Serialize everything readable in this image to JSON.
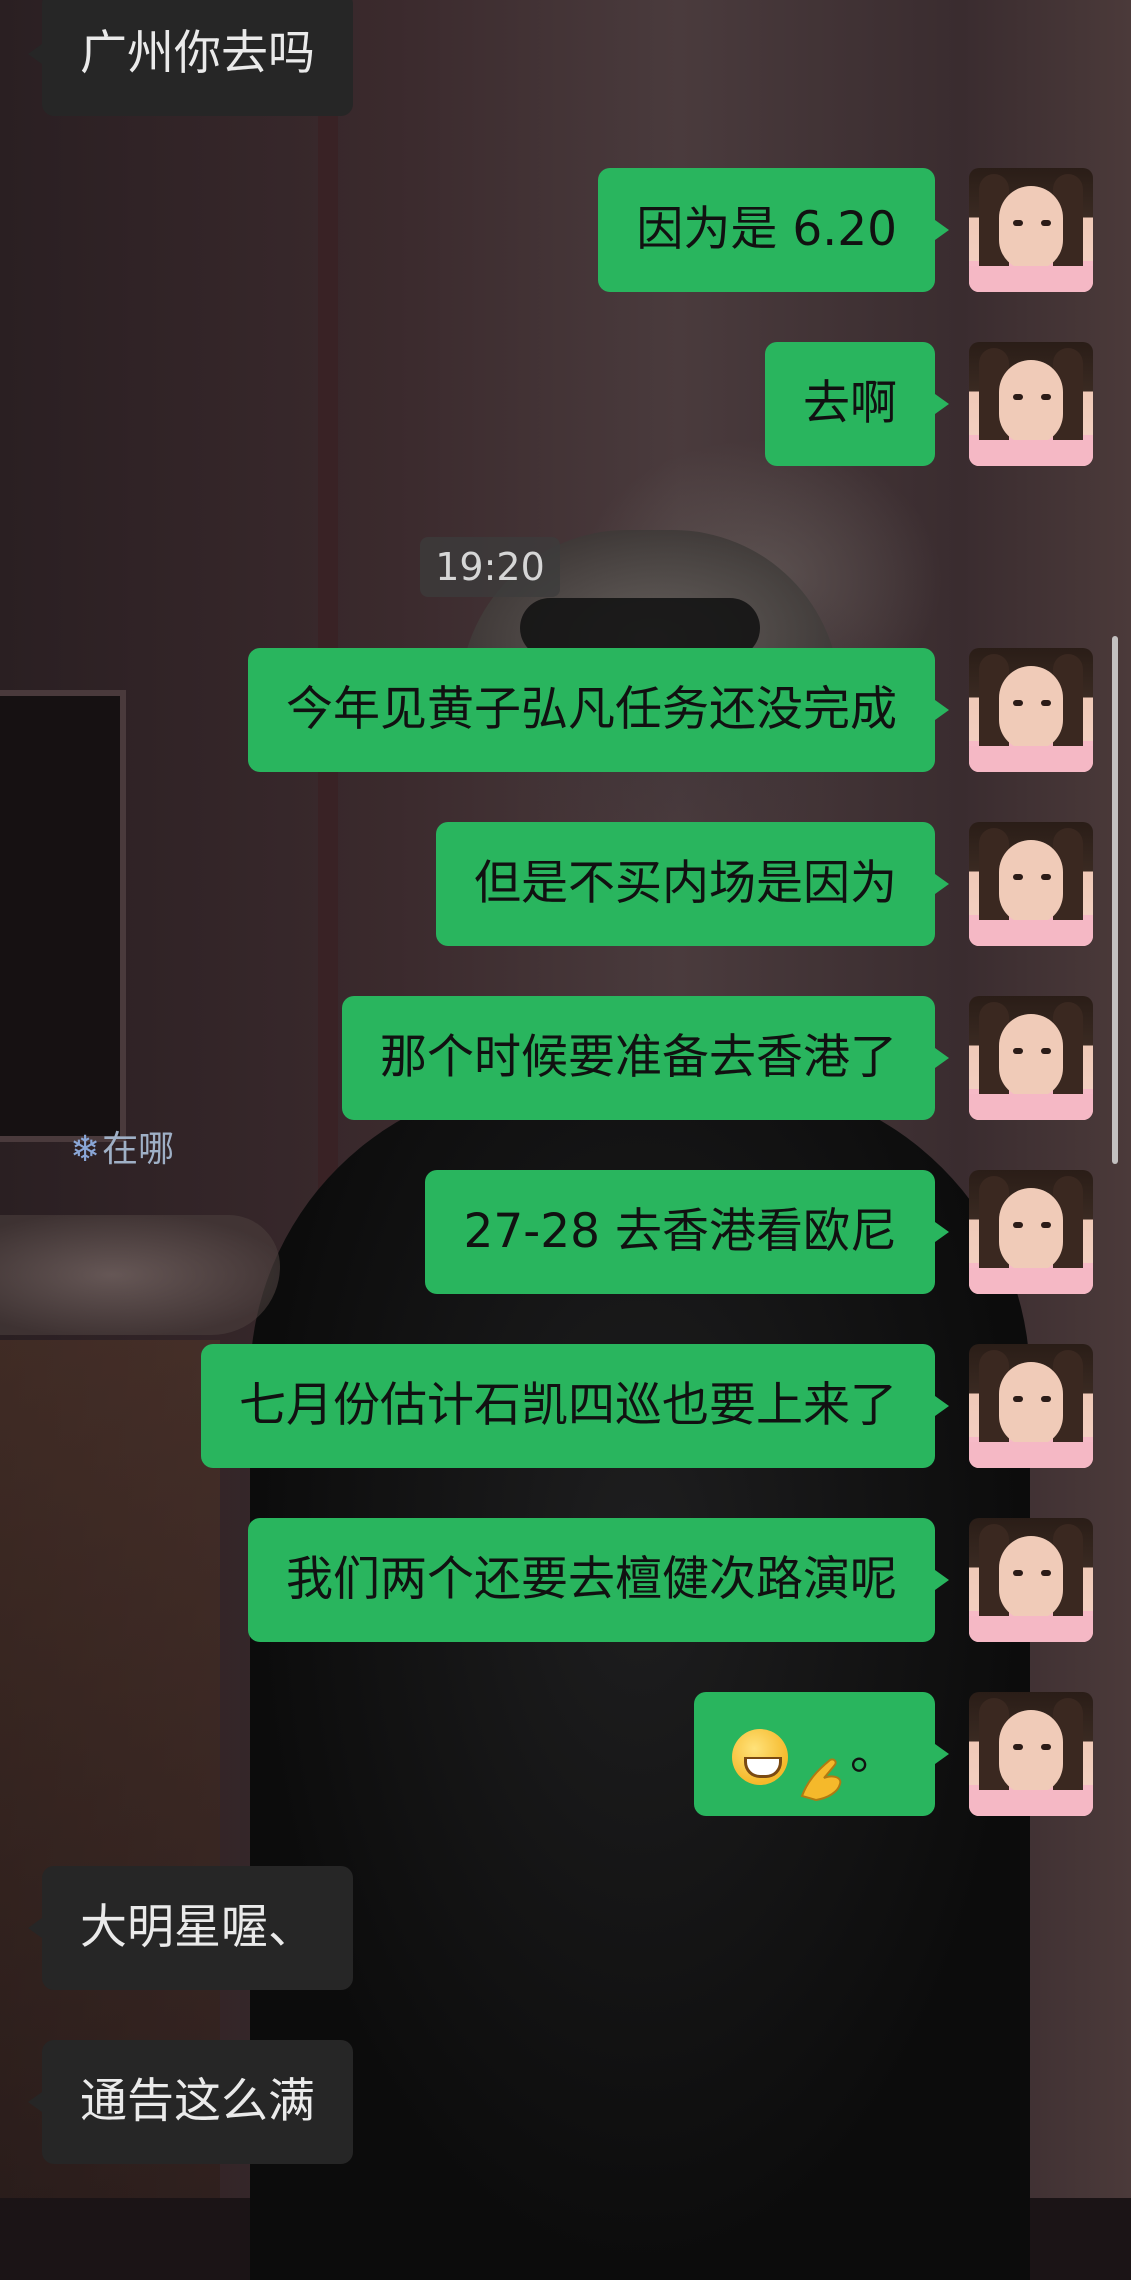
{
  "chat": {
    "timestamp": "19:20",
    "location_pin": "在哪",
    "messages": [
      {
        "side": "other",
        "text": "广州你去吗"
      },
      {
        "side": "me",
        "text": "因为是 6.20"
      },
      {
        "side": "me",
        "text": "去啊"
      },
      {
        "side": "me",
        "text": "今年见黄子弘凡任务还没完成"
      },
      {
        "side": "me",
        "text": "但是不买内场是因为"
      },
      {
        "side": "me",
        "text": "那个时候要准备去香港了"
      },
      {
        "side": "me",
        "text": "27-28 去香港看欧尼"
      },
      {
        "side": "me",
        "text": "七月份估计石凯四巡也要上来了"
      },
      {
        "side": "me",
        "text": "我们两个还要去檀健次路演呢"
      },
      {
        "side": "me",
        "text": "。",
        "emojis": [
          "grinning-face-emoji",
          "ok-hand-emoji"
        ]
      },
      {
        "side": "other",
        "text": "大明星喔、"
      },
      {
        "side": "other",
        "text": "通告这么满"
      }
    ]
  }
}
